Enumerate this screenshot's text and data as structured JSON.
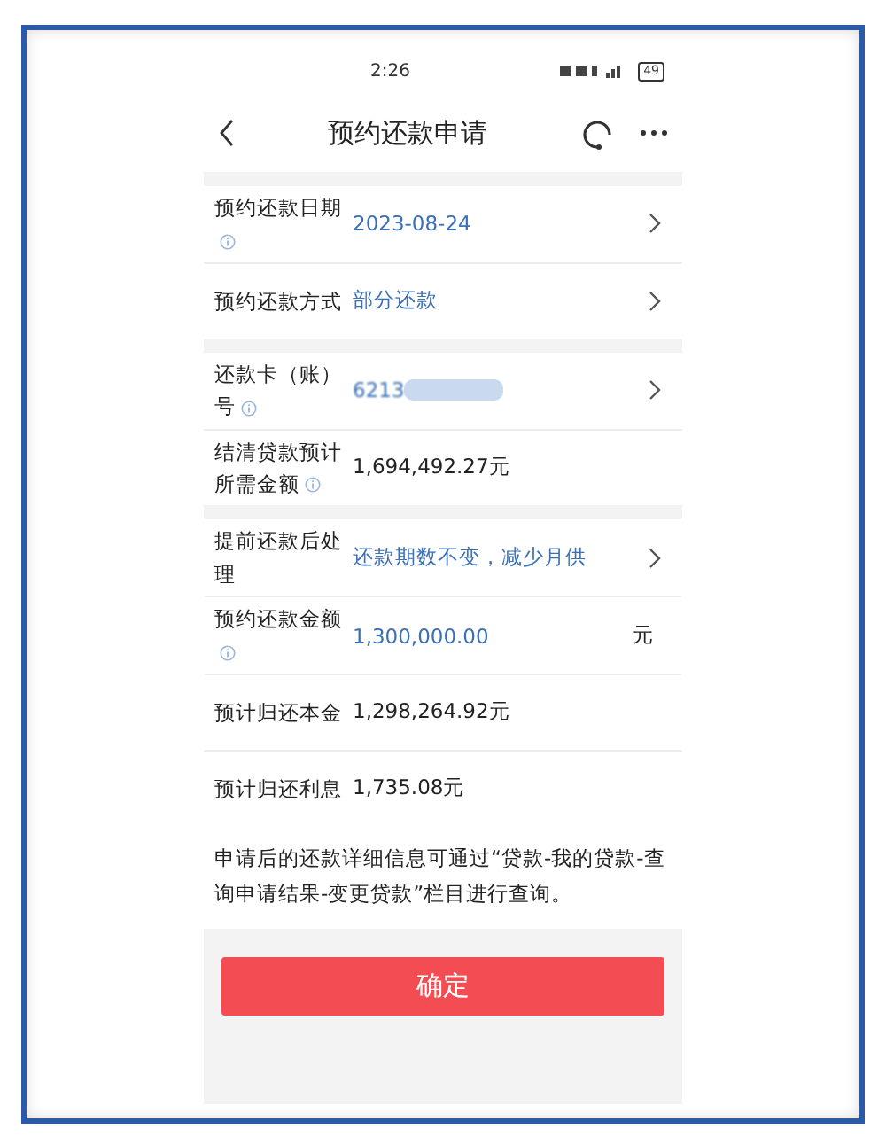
{
  "status_bar": {
    "time": "2:26",
    "battery": "49"
  },
  "nav": {
    "title": "预约还款申请"
  },
  "sections": [
    {
      "rows": [
        {
          "kind": "select",
          "label": "预约还款日期",
          "info": true,
          "value": "2023-08-24"
        },
        {
          "kind": "select",
          "label": "预约还款方式",
          "info": false,
          "value": "部分还款"
        }
      ]
    },
    {
      "rows": [
        {
          "kind": "masked",
          "label": "还款卡（账）号",
          "info": true,
          "value": "6213"
        },
        {
          "kind": "plain",
          "label": "结清贷款预计所需金额",
          "info": true,
          "value": "1,694,492.27元"
        }
      ]
    },
    {
      "rows": [
        {
          "kind": "select",
          "label": "提前还款后处理",
          "info": false,
          "value": "还款期数不变，减少月供"
        },
        {
          "kind": "amount",
          "label": "预约还款金额",
          "info": true,
          "value": "1,300,000.00",
          "unit": "元"
        },
        {
          "kind": "plain",
          "label": "预计归还本金",
          "info": false,
          "value": "1,298,264.92元"
        },
        {
          "kind": "plain",
          "label": "预计归还利息",
          "info": false,
          "value": "1,735.08元"
        }
      ]
    }
  ],
  "note": "申请后的还款详细信息可通过“贷款-我的贷款-查询申请结果-变更贷款”栏目进行查询。",
  "confirm_button": "确定"
}
